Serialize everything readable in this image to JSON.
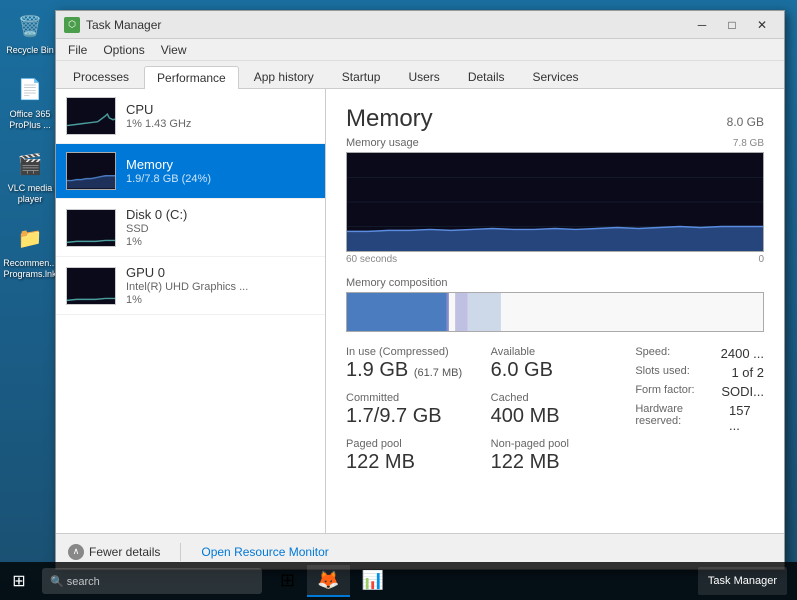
{
  "window": {
    "title": "Task Manager"
  },
  "menu": {
    "items": [
      "File",
      "Options",
      "View"
    ]
  },
  "tabs": {
    "items": [
      "Processes",
      "Performance",
      "App history",
      "Startup",
      "Users",
      "Details",
      "Services"
    ],
    "active": "Performance"
  },
  "left_panel": {
    "items": [
      {
        "id": "cpu",
        "name": "CPU",
        "detail": "1%  1.43 GHz",
        "active": false
      },
      {
        "id": "memory",
        "name": "Memory",
        "detail": "1.9/7.8 GB (24%)",
        "active": true
      },
      {
        "id": "disk",
        "name": "Disk 0 (C:)",
        "detail_line1": "SSD",
        "detail_line2": "1%",
        "active": false
      },
      {
        "id": "gpu",
        "name": "GPU 0",
        "detail_line1": "Intel(R) UHD Graphics ...",
        "detail_line2": "1%",
        "active": false
      }
    ]
  },
  "memory_panel": {
    "title": "Memory",
    "total": "8.0 GB",
    "graph": {
      "usage_label": "Memory usage",
      "max_label": "7.8 GB",
      "time_start": "60 seconds",
      "time_end": "0"
    },
    "composition": {
      "label": "Memory composition",
      "in_use_pct": 24,
      "cached_pct": 10
    },
    "stats": {
      "in_use_label": "In use (Compressed)",
      "in_use_value": "1.9 GB",
      "in_use_sub": "(61.7 MB)",
      "available_label": "Available",
      "available_value": "6.0 GB",
      "speed_label": "Speed:",
      "speed_value": "2400 ...",
      "committed_label": "Committed",
      "committed_value": "1.7/9.7 GB",
      "cached_label": "Cached",
      "cached_value": "400 MB",
      "slots_label": "Slots used:",
      "slots_value": "1 of 2",
      "form_label": "Form factor:",
      "form_value": "SODI...",
      "paged_label": "Paged pool",
      "paged_value": "122 MB",
      "nonpaged_label": "Non-paged pool",
      "nonpaged_value": "122 MB",
      "hardware_label": "Hardware reserved:",
      "hardware_value": "157 ..."
    }
  },
  "bottom_bar": {
    "fewer_details": "Fewer details",
    "open_monitor": "Open Resource Monitor"
  },
  "taskbar": {
    "search_placeholder": "🔍 search",
    "task_manager_label": "Task Manager"
  },
  "desktop_icons": [
    {
      "label": "Recycle Bin",
      "icon": "🗑️"
    },
    {
      "label": "Office 365 ProPlus ...",
      "icon": "📄"
    },
    {
      "label": "VLC media player",
      "icon": "🎬"
    },
    {
      "label": "Recommen... Programs.lnk",
      "icon": "📁"
    }
  ]
}
